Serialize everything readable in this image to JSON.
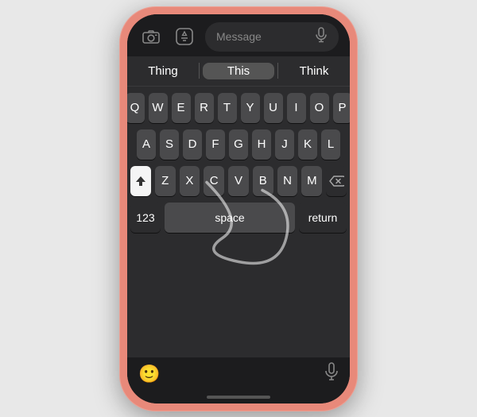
{
  "phone": {
    "top_bar": {
      "camera_icon": "📷",
      "appstore_icon": "🅐",
      "message_placeholder": "Message",
      "mic_icon": "🎙"
    },
    "predictive": {
      "left": "Thing",
      "center": "This",
      "right": "Think"
    },
    "keyboard": {
      "row1": [
        "Q",
        "W",
        "E",
        "R",
        "T",
        "Y",
        "U",
        "I",
        "O",
        "P"
      ],
      "row2": [
        "A",
        "S",
        "D",
        "F",
        "G",
        "H",
        "J",
        "K",
        "L"
      ],
      "row3": [
        "Z",
        "X",
        "C",
        "V",
        "B",
        "N",
        "M"
      ],
      "numbers_label": "123",
      "space_label": "space",
      "return_label": "return"
    },
    "bottom": {
      "emoji_icon": "😊",
      "mic_icon": "🎙"
    }
  }
}
